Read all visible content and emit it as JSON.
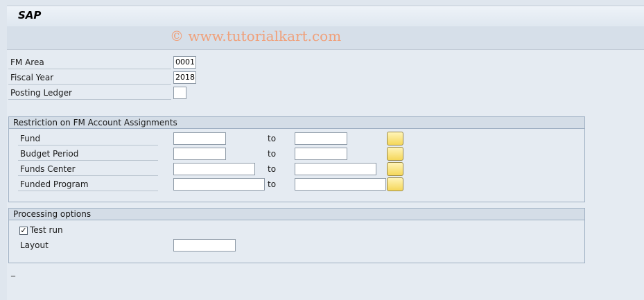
{
  "window": {
    "title": "SAP"
  },
  "toolbar": {
    "watermark": "© www.tutorialkart.com"
  },
  "header": {
    "fm_area": {
      "label": "FM Area",
      "value": "0001"
    },
    "fiscal_year": {
      "label": "Fiscal Year",
      "value": "2018"
    },
    "posting_ledger": {
      "label": "Posting Ledger",
      "value": ""
    }
  },
  "restriction": {
    "title": "Restriction on FM Account Assignments",
    "to_label": "to",
    "fund": {
      "label": "Fund",
      "from": "",
      "to": ""
    },
    "budget_period": {
      "label": "Budget Period",
      "from": "",
      "to": ""
    },
    "funds_center": {
      "label": "Funds Center",
      "from": "",
      "to": ""
    },
    "funded_program": {
      "label": "Funded Program",
      "from": "",
      "to": ""
    }
  },
  "processing": {
    "title": "Processing options",
    "test_run": {
      "label": "Test run",
      "checked": true,
      "mark": "✓"
    },
    "layout": {
      "label": "Layout",
      "value": ""
    }
  },
  "status": {
    "text": "_"
  }
}
